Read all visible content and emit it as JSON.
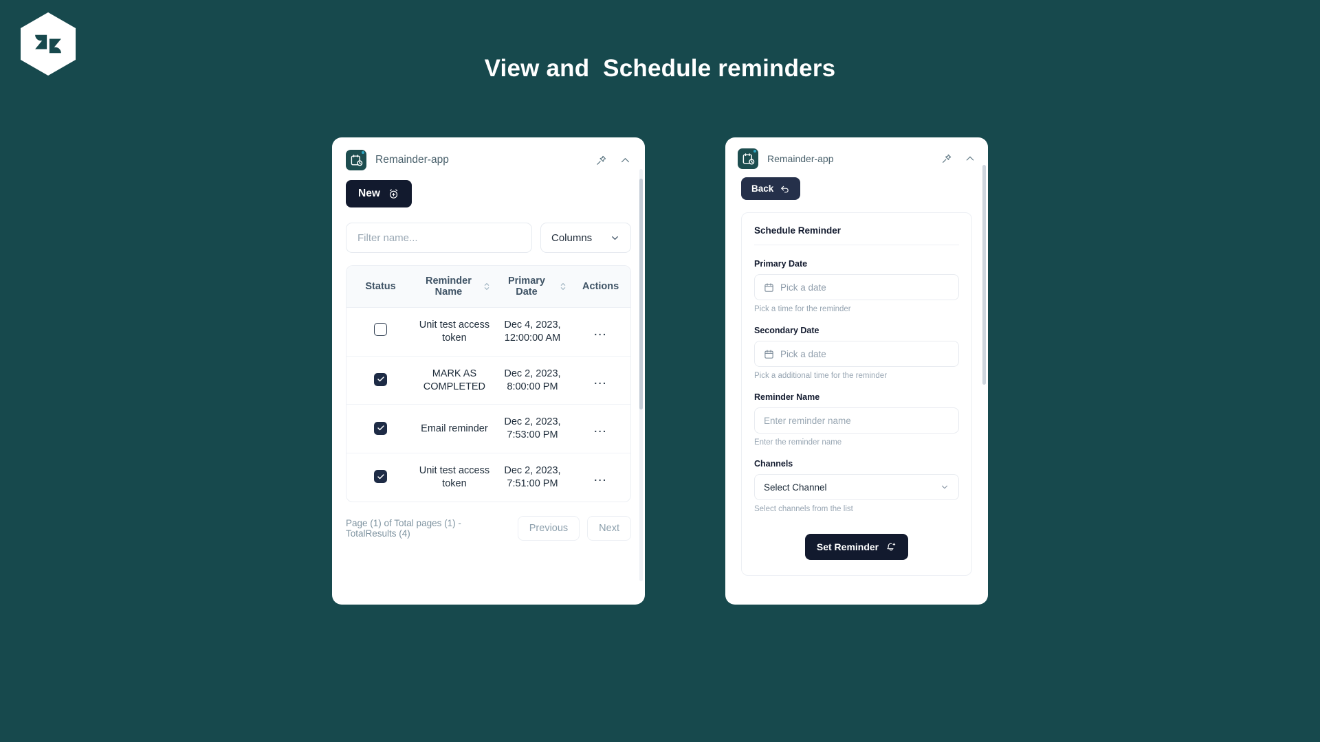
{
  "page": {
    "title": "View and  Schedule reminders",
    "background_color": "#17494d",
    "logo_name": "zendesk-logo"
  },
  "left_panel": {
    "app_name": "Remainder-app",
    "pin_icon": "pin-icon",
    "collapse_icon": "chevron-up-icon",
    "new_button": "New",
    "new_button_icon": "alarm-plus-icon",
    "filter_placeholder": "Filter name...",
    "filter_value": "",
    "columns_button": "Columns",
    "columns_icon": "chevron-down-icon",
    "table": {
      "headers": [
        "Status",
        "Reminder Name",
        "Primary Date",
        "Actions"
      ],
      "sortable": [
        "Reminder Name",
        "Primary Date"
      ],
      "rows": [
        {
          "checked": false,
          "name": "Unit test access token",
          "date": "Dec 4, 2023, 12:00:00 AM",
          "actions": "…"
        },
        {
          "checked": true,
          "name": "MARK AS COMPLETED",
          "date": "Dec 2, 2023, 8:00:00 PM",
          "actions": "…"
        },
        {
          "checked": true,
          "name": "Email reminder",
          "date": "Dec 2, 2023, 7:53:00 PM",
          "actions": "…"
        },
        {
          "checked": true,
          "name": "Unit test access token",
          "date": "Dec 2, 2023, 7:51:00 PM",
          "actions": "…"
        }
      ]
    },
    "pagination": {
      "info": "Page (1) of Total pages (1) - TotalResults (4)",
      "previous": "Previous",
      "next": "Next"
    }
  },
  "right_panel": {
    "app_name": "Remainder-app",
    "pin_icon": "pin-icon",
    "collapse_icon": "chevron-up-icon",
    "back_button": "Back",
    "back_icon": "undo-arrow-icon",
    "form_title": "Schedule Reminder",
    "fields": {
      "primary_date": {
        "label": "Primary Date",
        "placeholder": "Pick a date",
        "value": "",
        "hint": "Pick a time for the reminder",
        "icon": "calendar-icon"
      },
      "secondary_date": {
        "label": "Secondary Date",
        "placeholder": "Pick a date",
        "value": "",
        "hint": "Pick a additional time for the reminder",
        "icon": "calendar-icon"
      },
      "reminder_name": {
        "label": "Reminder Name",
        "placeholder": "Enter reminder name",
        "value": "",
        "hint": "Enter the reminder name"
      },
      "channels": {
        "label": "Channels",
        "selected": "Select Channel",
        "hint": "Select channels from the list",
        "icon": "chevron-down-icon"
      }
    },
    "submit_button": "Set Reminder",
    "submit_icon": "bell-plus-icon"
  }
}
